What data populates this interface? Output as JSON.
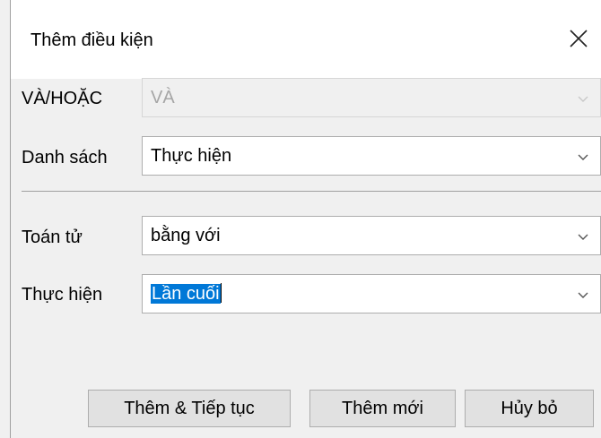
{
  "dialog": {
    "title": "Thêm điều kiện",
    "close_icon": "close-icon"
  },
  "fields": {
    "and_or": {
      "label": "VÀ/HOẶC",
      "value": "VÀ",
      "disabled": true
    },
    "list": {
      "label": "Danh sách",
      "value": "Thực hiện"
    },
    "operator": {
      "label": "Toán tử",
      "value": "bằng với"
    },
    "perform": {
      "label": "Thực hiện",
      "value": "Lần cuối"
    }
  },
  "buttons": {
    "add_continue": "Thêm & Tiếp tục",
    "add_new": "Thêm mới",
    "cancel": "Hủy bỏ"
  },
  "colors": {
    "selection": "#0078d7",
    "window_bg": "#f0f0f0"
  }
}
